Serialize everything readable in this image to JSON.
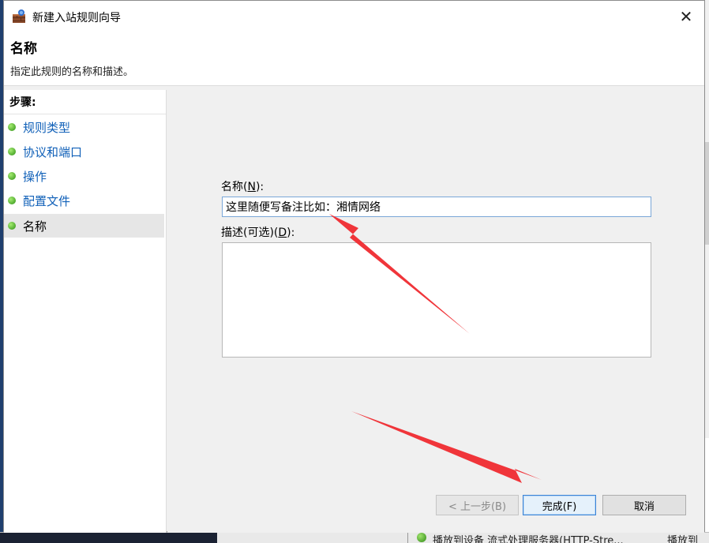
{
  "window": {
    "title": "新建入站规则向导",
    "close_glyph": "✕"
  },
  "header": {
    "title": "名称",
    "description": "指定此规则的名称和描述。"
  },
  "steps": {
    "heading": "步骤:",
    "items": [
      {
        "label": "规则类型"
      },
      {
        "label": "协议和端口"
      },
      {
        "label": "操作"
      },
      {
        "label": "配置文件"
      },
      {
        "label": "名称"
      }
    ]
  },
  "form": {
    "name_label_pre": "名称(",
    "name_label_key": "N",
    "name_label_post": "):",
    "name_value": "这里随便写备注比如：湘情网络",
    "desc_label_pre": "描述(可选)(",
    "desc_label_key": "D",
    "desc_label_post": "):",
    "desc_value": ""
  },
  "buttons": {
    "back": "< 上一步(B)",
    "finish": "完成(F)",
    "cancel": "取消"
  },
  "background": {
    "status_text": "播放到设备 流式处理服务器(HTTP-Stre...",
    "status_text2": "播放到"
  },
  "colors": {
    "link_blue": "#1060b8",
    "arrow_red": "#f0353a",
    "focus_border": "#3b84d6"
  }
}
